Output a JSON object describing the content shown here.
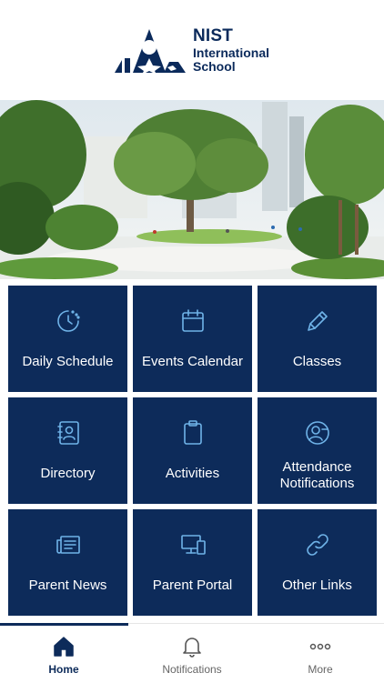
{
  "header": {
    "logo_line1": "NIST",
    "logo_line2": "International",
    "logo_line3": "School"
  },
  "hero": {
    "description_icon": "campus-courtyard-photo"
  },
  "tiles": [
    {
      "label": "Daily Schedule",
      "icon": "clock-icon"
    },
    {
      "label": "Events Calendar",
      "icon": "calendar-icon"
    },
    {
      "label": "Classes",
      "icon": "pencil-icon"
    },
    {
      "label": "Directory",
      "icon": "contact-book-icon"
    },
    {
      "label": "Activities",
      "icon": "clipboard-icon"
    },
    {
      "label": "Attendance Notifications",
      "icon": "user-minus-icon"
    },
    {
      "label": "Parent News",
      "icon": "newspaper-icon"
    },
    {
      "label": "Parent Portal",
      "icon": "devices-icon"
    },
    {
      "label": "Other Links",
      "icon": "link-icon"
    }
  ],
  "bottom_nav": [
    {
      "label": "Home",
      "icon": "home-icon",
      "active": true
    },
    {
      "label": "Notifications",
      "icon": "bell-icon",
      "active": false
    },
    {
      "label": "More",
      "icon": "more-dots-icon",
      "active": false
    }
  ],
  "colors": {
    "tile_bg": "#0d2b5a",
    "icon_accent": "#6fb3e8",
    "brand_navy": "#0b2a5b"
  }
}
